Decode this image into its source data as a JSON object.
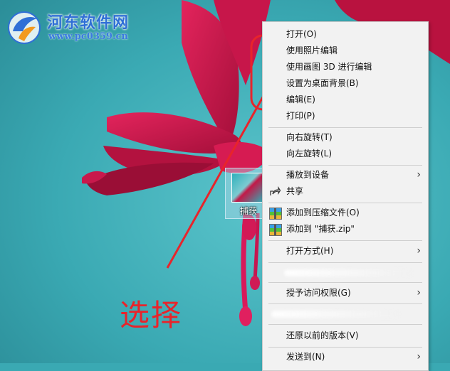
{
  "watermark": {
    "title": "河东软件网",
    "url": "www.pc0359.cn"
  },
  "desktop_icon": {
    "label": "捕获"
  },
  "annotation": {
    "text": "选择",
    "color": "#e8242b"
  },
  "context_menu": {
    "items": [
      {
        "label": "打开(O)"
      },
      {
        "label": "使用照片编辑"
      },
      {
        "label": "使用画图 3D 进行编辑"
      },
      {
        "label": "设置为桌面背景(B)"
      },
      {
        "label": "编辑(E)"
      },
      {
        "label": "打印(P)"
      },
      {
        "label": "向右旋转(T)"
      },
      {
        "label": "向左旋转(L)"
      },
      {
        "label": "播放到设备",
        "submenu": true,
        "arrow": "›"
      },
      {
        "label": "共享",
        "icon": "share-icon"
      },
      {
        "label": "添加到压缩文件(O)",
        "icon": "archive-icon"
      },
      {
        "label": "添加到 \"捕获.zip\"",
        "icon": "archive-icon"
      },
      {
        "label": "打开方式(H)",
        "submenu": true,
        "arrow": "›"
      },
      {
        "label": "授予访问权限(G)",
        "submenu": true,
        "arrow": "›"
      },
      {
        "label": "还原以前的版本(V)"
      },
      {
        "label": "发送到(N)",
        "submenu": true,
        "arrow": "›"
      }
    ]
  },
  "colors": {
    "background": "#3aa9b3",
    "flower": "#c21948",
    "highlight_box": "#e8242b",
    "menu_bg": "#f2f2f2"
  }
}
